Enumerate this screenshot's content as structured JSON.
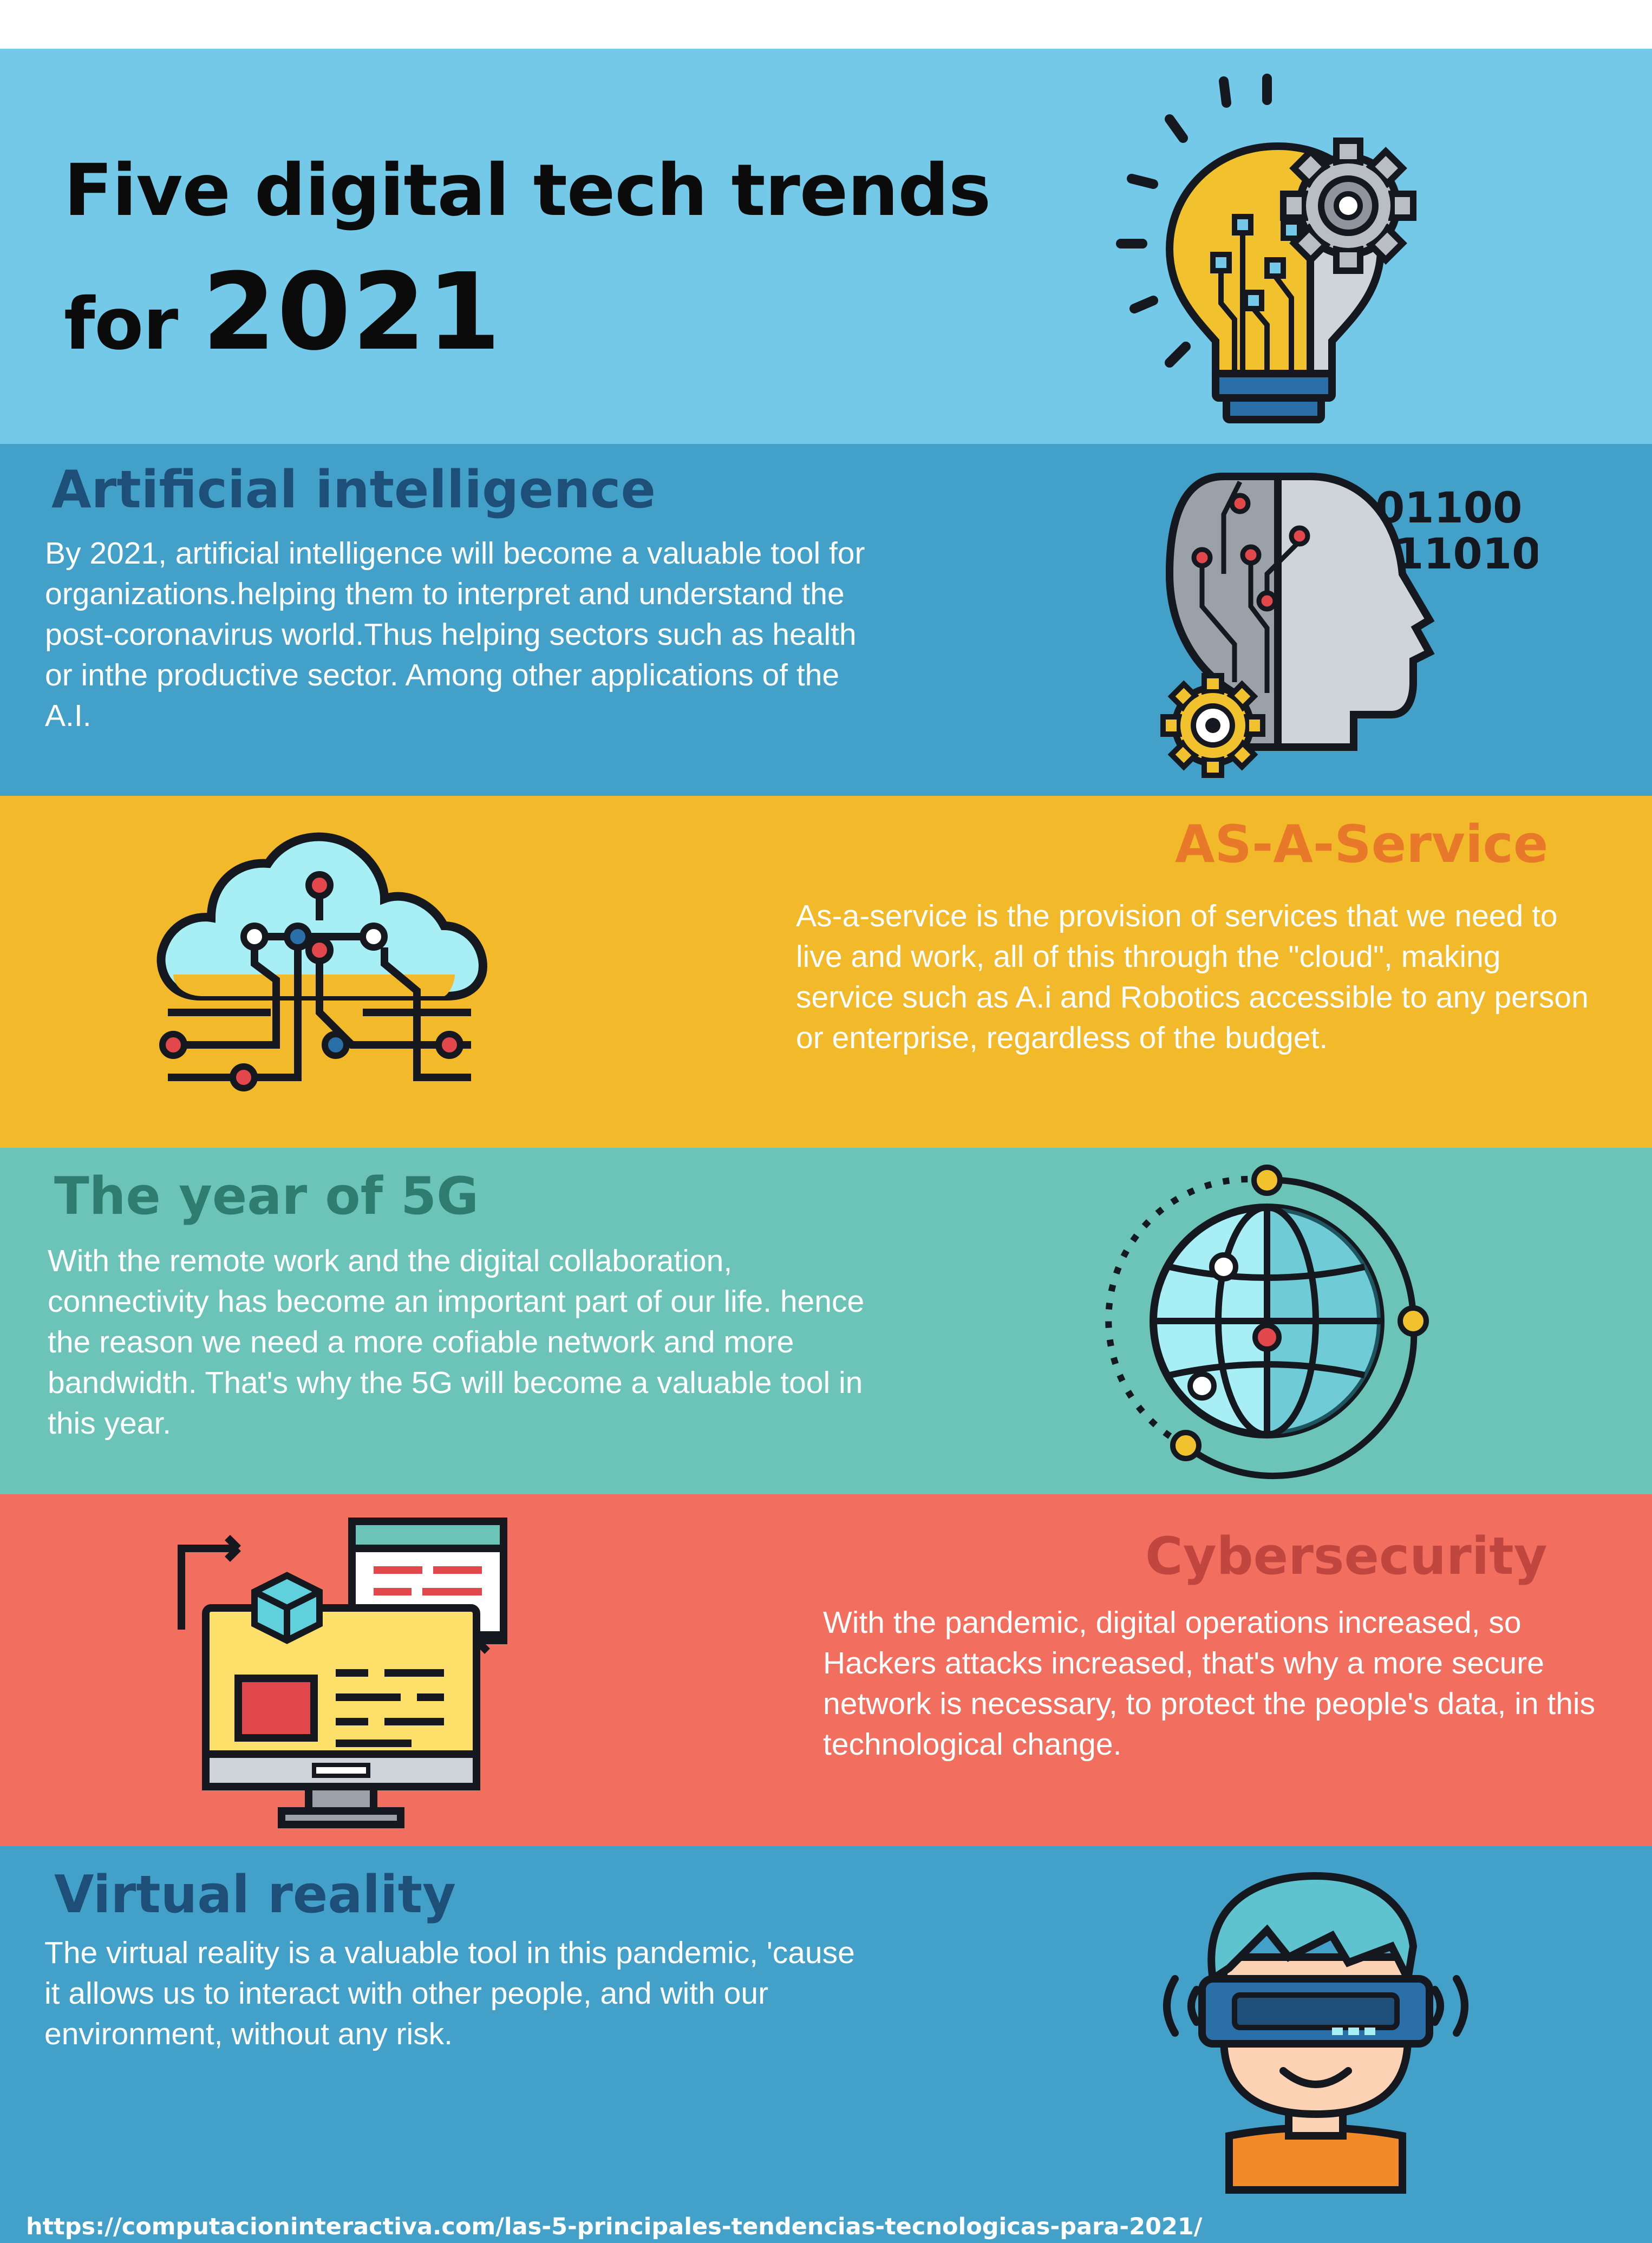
{
  "header": {
    "title_line1": "Five digital tech trends",
    "title_for": "for",
    "title_year": "2021"
  },
  "sections": [
    {
      "heading": "Artificial intelligence",
      "text": "By 2021, artificial intelligence will become a valuable tool for organizations.helping them to interpret and understand the post-coronavirus world.Thus helping sectors such as health or inthe productive sector. Among other applications of the A.I.",
      "binary_line1": "01100",
      "binary_line2": "11010"
    },
    {
      "heading": "AS-A-Service",
      "text": "As-a-service is the provision of services that we need to live and work, all of this through the \"cloud\", making service such as A.i  and Robotics accessible to any person or enterprise, regardless of the budget."
    },
    {
      "heading": "The year of 5G",
      "text": "With the remote work and the digital collaboration, connectivity has become an important part of our life. hence the reason  we need a more cofiable network and more bandwidth. That's why the 5G will become a valuable tool in this year."
    },
    {
      "heading": "Cybersecurity",
      "text": "With the pandemic, digital operations increased, so Hackers attacks increased, that's why a more secure network is necessary, to protect the people's data, in this technological change."
    },
    {
      "heading": "Virtual reality",
      "text": "The virtual reality is a valuable tool in this pandemic, 'cause it allows us to interact with other people, and with our environment, without any risk."
    }
  ],
  "footer": {
    "url": "https://computacioninteractiva.com/las-5-principales-tendencias-tecnologicas-para-2021/"
  },
  "colors": {
    "header_bg": "#74c9e8",
    "ai_bg": "#43a1c9",
    "service_bg": "#f2b92a",
    "fiveg_bg": "#6cc4b9",
    "cyber_bg": "#f26e5f",
    "vr_bg": "#43a1c9",
    "ai_heading": "#1d4f78",
    "service_heading": "#e8782a",
    "fiveg_heading": "#2f7d71",
    "cyber_heading": "#c0463f",
    "vr_heading": "#1d4f78"
  },
  "icons": [
    "lightbulb-gear-icon",
    "robot-head-icon",
    "cloud-network-icon",
    "globe-network-icon",
    "computer-screen-icon",
    "vr-headset-person-icon"
  ]
}
